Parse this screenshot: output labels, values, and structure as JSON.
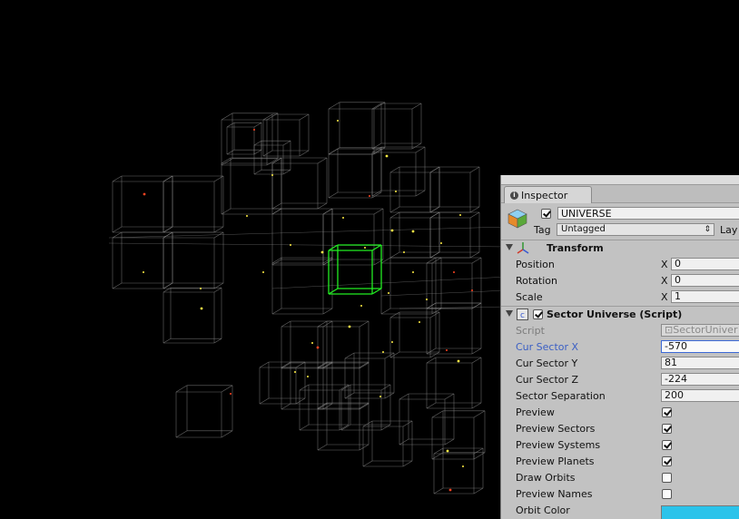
{
  "inspector": {
    "tab_label": "Inspector",
    "object_name": "UNIVERSE",
    "object_active": true,
    "tag_label": "Tag",
    "tag_value": "Untagged",
    "layer_label": "Lay"
  },
  "transform": {
    "title": "Transform",
    "rows": [
      {
        "label": "Position",
        "axis": "X",
        "value": "0"
      },
      {
        "label": "Rotation",
        "axis": "X",
        "value": "0"
      },
      {
        "label": "Scale",
        "axis": "X",
        "value": "1"
      }
    ]
  },
  "sector_universe": {
    "title": "Sector Universe (Script)",
    "enabled": true,
    "script_label": "Script",
    "script_value": "SectorUniver",
    "fields": [
      {
        "label": "Cur Sector X",
        "value": "-570"
      },
      {
        "label": "Cur Sector Y",
        "value": "81"
      },
      {
        "label": "Cur Sector Z",
        "value": "-224"
      },
      {
        "label": "Sector Separation",
        "value": "200"
      }
    ],
    "toggles": [
      {
        "label": "Preview",
        "checked": true
      },
      {
        "label": "Preview Sectors",
        "checked": true
      },
      {
        "label": "Preview Systems",
        "checked": true
      },
      {
        "label": "Preview Planets",
        "checked": true
      },
      {
        "label": "Draw Orbits",
        "checked": false
      },
      {
        "label": "Preview Names",
        "checked": false
      }
    ],
    "orbit_color_label": "Orbit Color",
    "orbit_color": "#2bc3ea"
  },
  "scene": {
    "wire_color": "#8a8a8a",
    "selected_color": "#22ee22",
    "star_color": "#ffee44",
    "star_color_alt": "#ff4422"
  }
}
